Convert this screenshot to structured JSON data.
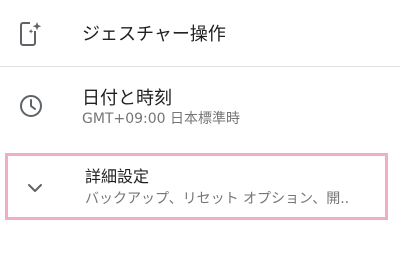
{
  "settings": {
    "gesture": {
      "title": "ジェスチャー操作",
      "icon": "gesture-phone-icon"
    },
    "datetime": {
      "title": "日付と時刻",
      "subtitle": "GMT+09:00 日本標準時",
      "icon": "clock-icon"
    },
    "advanced": {
      "title": "詳細設定",
      "subtitle": "バックアップ、リセット オプション、開..",
      "icon": "chevron-down-icon"
    }
  },
  "colors": {
    "highlight_border": "#f1acc8",
    "divider": "#e0e0e0",
    "icon": "#5f6368",
    "subtitle": "#757575"
  }
}
